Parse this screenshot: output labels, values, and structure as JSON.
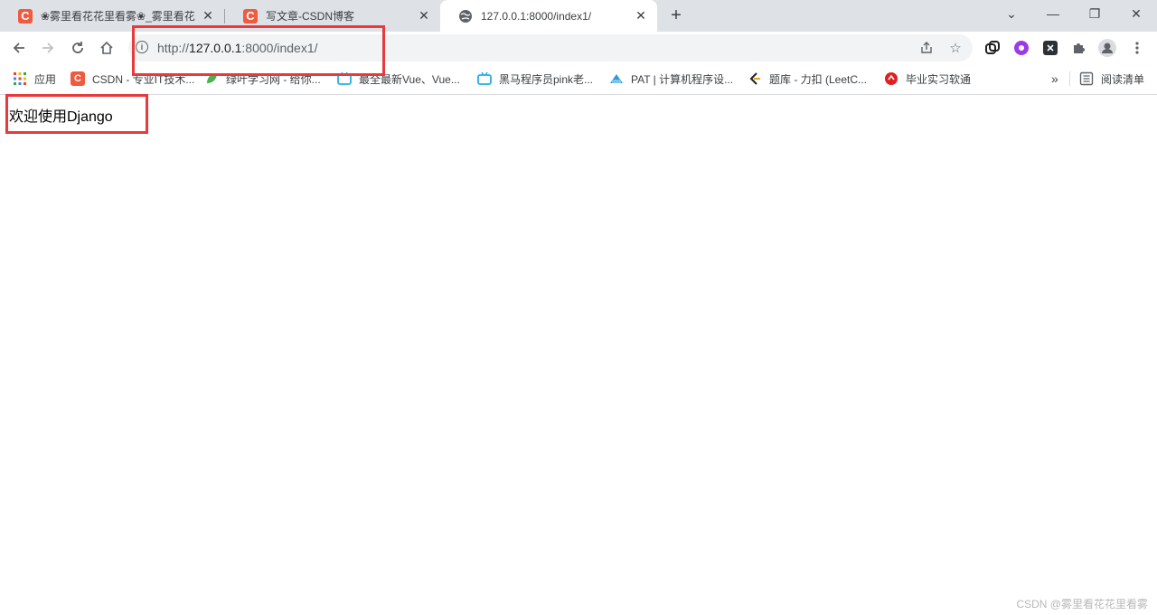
{
  "tabs": [
    {
      "title": "❀雾里看花花里看雾❀_雾里看花",
      "favicon": "C",
      "close": "✕"
    },
    {
      "title": "写文章-CSDN博客",
      "favicon": "C",
      "close": "✕"
    },
    {
      "title": "127.0.0.1:8000/index1/",
      "close": "✕"
    }
  ],
  "new_tab": "+",
  "window_controls": {
    "tab_search": "⌄",
    "minimize": "—",
    "restore": "❐",
    "close": "✕"
  },
  "address": {
    "scheme": "http://",
    "host": "127.0.0.1",
    "rest": ":8000/index1/"
  },
  "bookmarks": {
    "apps": "应用",
    "items": [
      {
        "label": "CSDN - 专业IT技术...",
        "icon_char": "C",
        "color": "#f05a3e"
      },
      {
        "label": "绿叶学习网 - 给你...",
        "icon_char": "",
        "color": "#4caf50"
      },
      {
        "label": "最全最新Vue、Vue...",
        "icon_char": "",
        "color": "#23ade5"
      },
      {
        "label": "黑马程序员pink老...",
        "icon_char": "",
        "color": "#23ade5"
      },
      {
        "label": "PAT | 计算机程序设...",
        "icon_char": "",
        "color": "#2e9bd6"
      },
      {
        "label": "题库 - 力扣 (LeetC...",
        "icon_char": "",
        "color": "#f0a020"
      },
      {
        "label": "毕业实习软通",
        "icon_char": "",
        "color": "#e02020"
      }
    ],
    "more": "»",
    "reading_list": "阅读清单"
  },
  "page": {
    "body_text": "欢迎使用Django"
  },
  "watermark": "CSDN @雾里看花花里看雾",
  "colors": {
    "highlight": "#e8393d",
    "csdn": "#f05a3e",
    "tabstrip": "#dee1e6"
  }
}
